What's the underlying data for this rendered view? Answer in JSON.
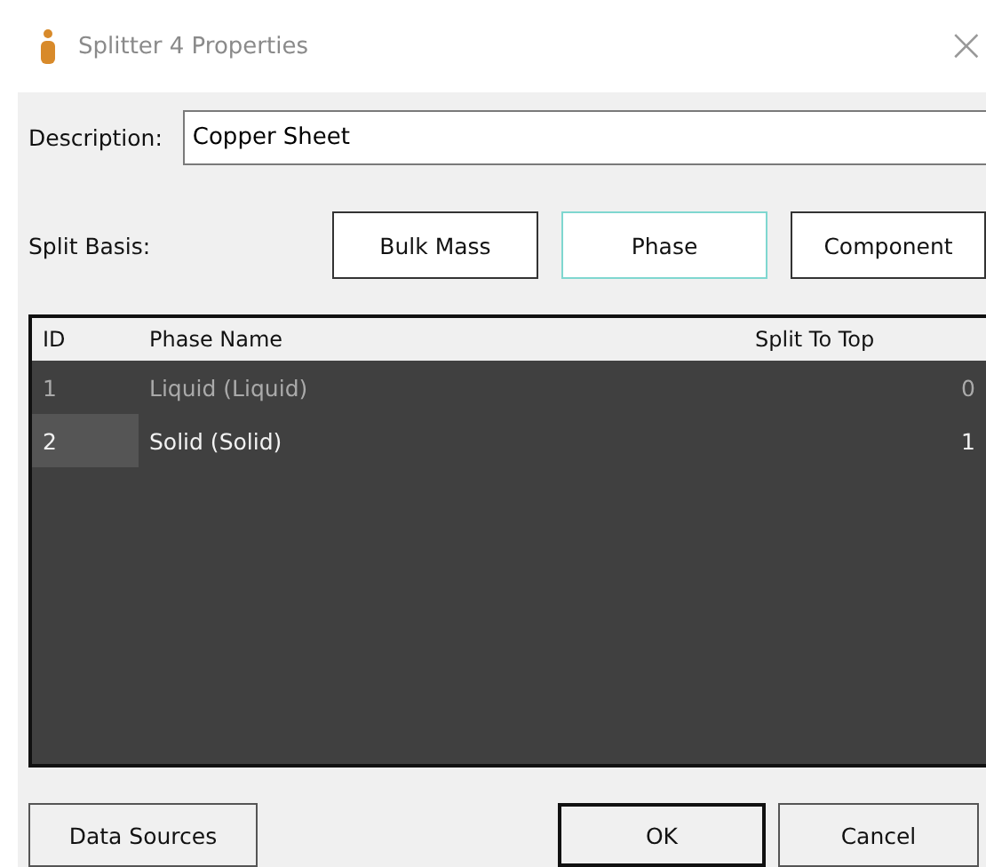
{
  "window": {
    "title": "Splitter 4 Properties",
    "close": "×"
  },
  "description": {
    "label": "Description:",
    "value": "Copper Sheet"
  },
  "split_basis": {
    "label": "Split Basis:",
    "options": [
      {
        "label": "Bulk Mass",
        "selected": false
      },
      {
        "label": "Phase",
        "selected": true
      },
      {
        "label": "Component",
        "selected": false
      }
    ]
  },
  "table": {
    "columns": [
      "ID",
      "Phase Name",
      "Split To Top"
    ],
    "rows": [
      {
        "id": "1",
        "name": "Liquid (Liquid)",
        "split": "0",
        "selected": false
      },
      {
        "id": "2",
        "name": "Solid (Solid)",
        "split": "1",
        "selected": true
      }
    ]
  },
  "buttons": {
    "data_sources": "Data Sources",
    "ok": "OK",
    "cancel": "Cancel"
  }
}
